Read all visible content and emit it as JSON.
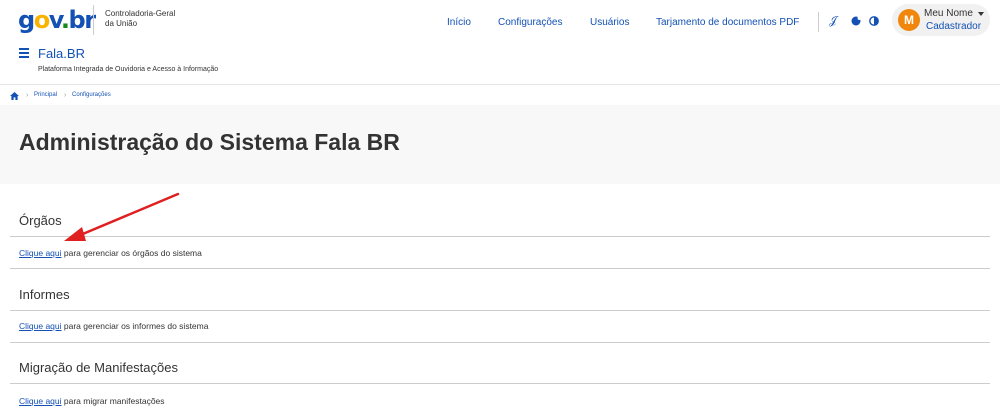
{
  "header": {
    "logo": {
      "g": "g",
      "o": "o",
      "v": "v",
      "dot": ".",
      "b": "b",
      "r": "r"
    },
    "org_line1": "Controladoria-Geral",
    "org_line2": "da União",
    "nav": [
      {
        "label": "Início"
      },
      {
        "label": "Configurações"
      },
      {
        "label": "Usuários"
      },
      {
        "label": "Tarjamento de documentos PDF"
      }
    ],
    "tools": [
      {
        "icon": "sign-language-icon",
        "glyph": "𝒥"
      },
      {
        "icon": "cookie-icon",
        "glyph": "●"
      },
      {
        "icon": "contrast-icon",
        "glyph": "◐"
      }
    ],
    "user": {
      "initial": "M",
      "name": "Meu Nome",
      "role": "Cadastrador"
    },
    "app_title": "Fala.BR",
    "app_subtitle": "Plataforma Integrada de Ouvidoria e Acesso à Informação",
    "menu_icon": "hamburger-icon"
  },
  "breadcrumb": {
    "home_icon": "home-icon",
    "items": [
      "Principal",
      "Configurações"
    ]
  },
  "page": {
    "title": "Administração do Sistema Fala BR"
  },
  "sections": [
    {
      "title": "Órgãos",
      "link": "Clique aqui",
      "text": " para gerenciar os órgãos do sistema"
    },
    {
      "title": "Informes",
      "link": "Clique aqui",
      "text": " para gerenciar os informes do sistema"
    },
    {
      "title": "Migração de Manifestações",
      "link": "Clique aqui",
      "text": " para migrar manifestações"
    }
  ],
  "annotation": {
    "color": "#e02020"
  },
  "colors": {
    "primary": "#1351b4",
    "avatar": "#f0870c",
    "text": "#333333"
  }
}
